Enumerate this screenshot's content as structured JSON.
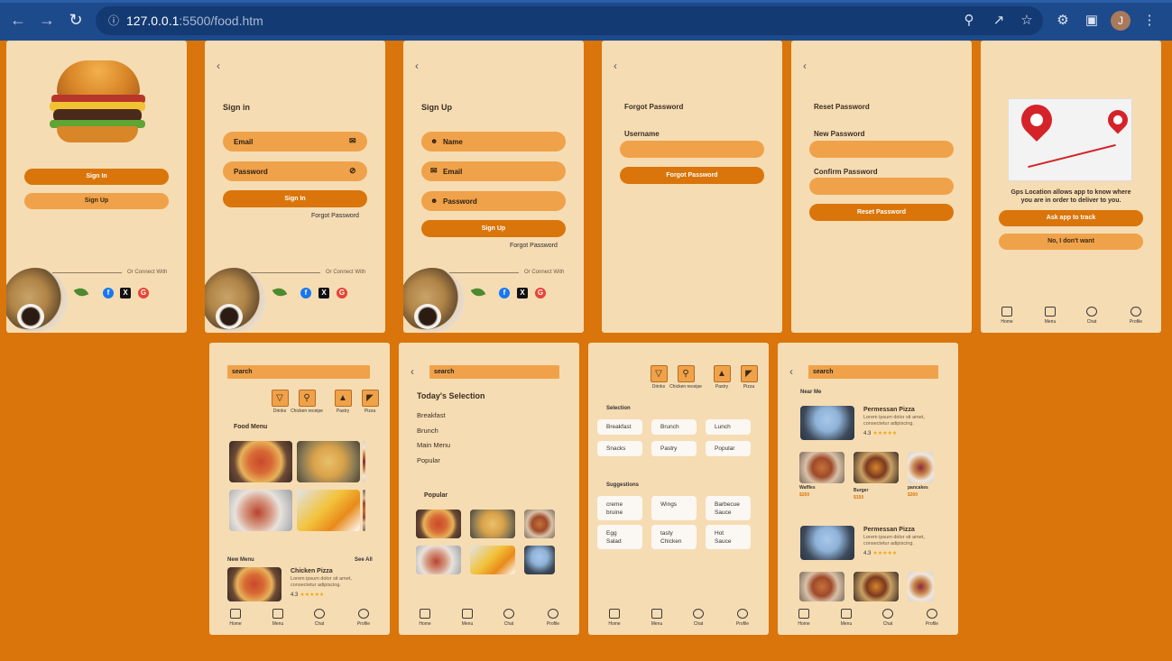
{
  "browser": {
    "url_host": "127.0.0.1",
    "url_path": ":5500/food.htm",
    "profile_initial": "J"
  },
  "welcome": {
    "sign_in": "Sign In",
    "sign_up": "Sign Up",
    "connect": "Or Connect With"
  },
  "signin": {
    "title": "Sign in",
    "email": "Email",
    "password": "Password",
    "submit": "Sign In",
    "forgot": "Forgot Password",
    "connect": "Or Connect With"
  },
  "signup": {
    "title": "Sign Up",
    "name": "Name",
    "email": "Email",
    "password": "Password",
    "submit": "Sign Up",
    "forgot": "Forgot Password",
    "connect": "Or Connect With"
  },
  "forgot": {
    "title": "Forgot Password",
    "username_label": "Username",
    "submit": "Forgot Password"
  },
  "reset": {
    "title": "Reset Password",
    "new_label": "New Password",
    "confirm_label": "Confirm Password",
    "submit": "Reset Password"
  },
  "gps": {
    "message_line1": "Gps Location allows app to know where",
    "message_line2": "you are in order to deliver to you.",
    "allow": "Ask app to track",
    "deny": "No, I don't want"
  },
  "nav": {
    "home": "Home",
    "menu": "Menu",
    "chat": "Chat",
    "profile": "Profile"
  },
  "categories": {
    "drinks": "Drinks",
    "chicken": "Chicken receipe",
    "pastry": "Pastry",
    "pizza": "Pizza"
  },
  "home": {
    "search": "search",
    "food_menu": "Food Menu",
    "new_menu": "New Menu",
    "see_all": "See All",
    "item_title": "Chicken Pizza",
    "item_desc_1": "Lorem ipsum dolor sit amet,",
    "item_desc_2": "consectetur adipiscing.",
    "rating": "4.3"
  },
  "selection_screen": {
    "search": "search",
    "heading": "Today's Selection",
    "items": [
      "Breakfast",
      "Brunch",
      "Main Menu",
      "Popular"
    ],
    "popular": "Popular"
  },
  "filters": {
    "selection_label": "Selection",
    "selection": [
      "Breakfast",
      "Brunch",
      "Lunch",
      "Snacks",
      "Pastry",
      "Popular"
    ],
    "suggestions_label": "Suggestions",
    "suggestions": [
      [
        "creme",
        "bruine"
      ],
      [
        "Wings",
        ""
      ],
      [
        "Barbecue",
        "Sauce"
      ],
      [
        "Egg",
        "Salad"
      ],
      [
        "tasty",
        "Chicken"
      ],
      [
        "Hot",
        "Sauce"
      ]
    ]
  },
  "nearme": {
    "search": "search",
    "heading": "Near Me",
    "title": "Permessan Pizza",
    "desc_1": "Lorem ipsum dolor sit amet,",
    "desc_2": "consectetur adipiscing.",
    "rating": "4.3",
    "items": [
      {
        "name": "Waffles",
        "price": "$200"
      },
      {
        "name": "Burger",
        "price": "$150"
      },
      {
        "name": "pancakes",
        "price": "$300"
      }
    ]
  }
}
